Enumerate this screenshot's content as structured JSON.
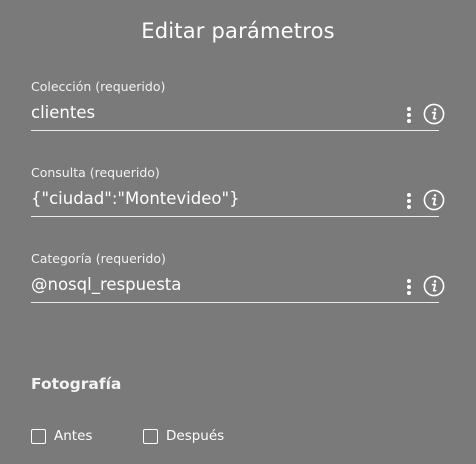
{
  "dialog": {
    "title": "Editar parámetros"
  },
  "fields": [
    {
      "label": "Colección (requerido)",
      "value": "clientes",
      "menu_icon": "kebab-menu-icon",
      "info_icon": "info-icon"
    },
    {
      "label": "Consulta (requerido)",
      "value": "{\"ciudad\":\"Montevideo\"}",
      "menu_icon": "kebab-menu-icon",
      "info_icon": "info-icon"
    },
    {
      "label": "Categoría (requerido)",
      "value": "@nosql_respuesta",
      "menu_icon": "kebab-menu-icon",
      "info_icon": "info-icon"
    }
  ],
  "photo_section": {
    "title": "Fotografía",
    "options": [
      {
        "label": "Antes",
        "checked": false
      },
      {
        "label": "Después",
        "checked": false
      }
    ]
  },
  "colors": {
    "background": "#7a7a7a",
    "text": "#ffffff"
  }
}
